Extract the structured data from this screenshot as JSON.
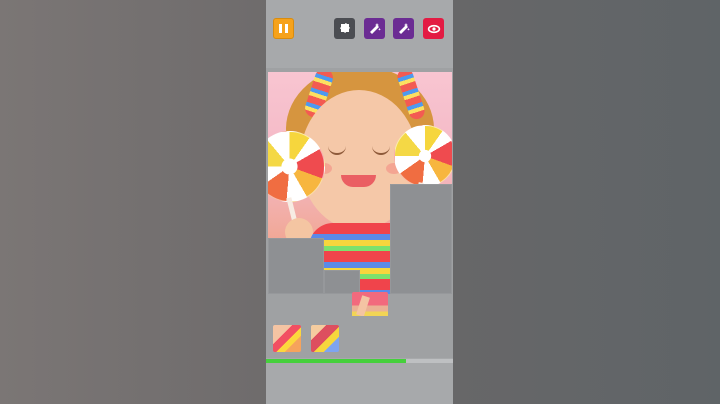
{
  "toolbar": {
    "buttons": [
      {
        "name": "pause",
        "icon": "pause-icon",
        "color": "#f6a21b"
      },
      {
        "name": "piece",
        "icon": "puzzle-piece-icon",
        "color": "#4b4d52"
      },
      {
        "name": "magic",
        "icon": "magic-icon",
        "color": "#6b2c93"
      },
      {
        "name": "magic",
        "icon": "magic-icon",
        "color": "#6b2c93"
      },
      {
        "name": "preview",
        "icon": "eye-icon",
        "color": "#e31b43"
      }
    ]
  },
  "board": {
    "loose_pieces_in_tray": 2,
    "placed_piece_outside_tray": 1
  },
  "progress": {
    "value": 0.75,
    "color": "#45d03c"
  }
}
